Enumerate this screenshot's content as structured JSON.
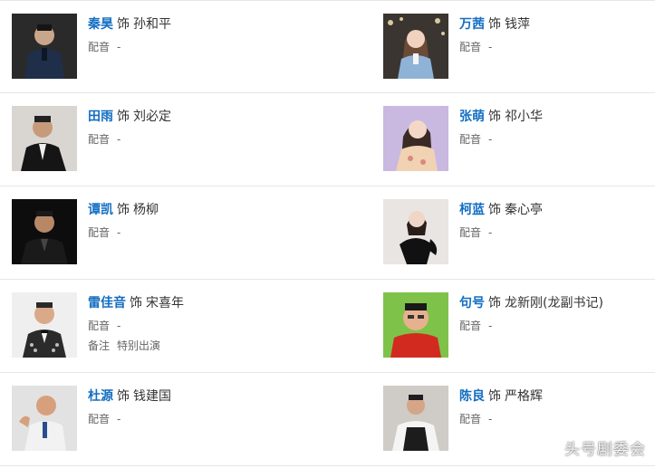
{
  "labels": {
    "as": "饰",
    "dub": "配音",
    "dash": "-",
    "note": "备注"
  },
  "cast": [
    {
      "actor": "秦昊",
      "role": "孙和平",
      "note": null
    },
    {
      "actor": "万茜",
      "role": "钱萍",
      "note": null
    },
    {
      "actor": "田雨",
      "role": "刘必定",
      "note": null
    },
    {
      "actor": "张萌",
      "role": "祁小华",
      "note": null
    },
    {
      "actor": "谭凯",
      "role": "杨柳",
      "note": null
    },
    {
      "actor": "柯蓝",
      "role": "秦心亭",
      "note": null
    },
    {
      "actor": "雷佳音",
      "role": "宋喜年",
      "note": "特别出演"
    },
    {
      "actor": "句号",
      "role": "龙新刚(龙副书记)",
      "note": null
    },
    {
      "actor": "杜源",
      "role": "钱建国",
      "note": null
    },
    {
      "actor": "陈良",
      "role": "严格辉",
      "note": null
    }
  ],
  "watermark": "头号剧委会",
  "colors": {
    "actor_link": "#136ec2",
    "text": "#333333",
    "meta": "#666666",
    "divider": "#e6e6e6"
  }
}
